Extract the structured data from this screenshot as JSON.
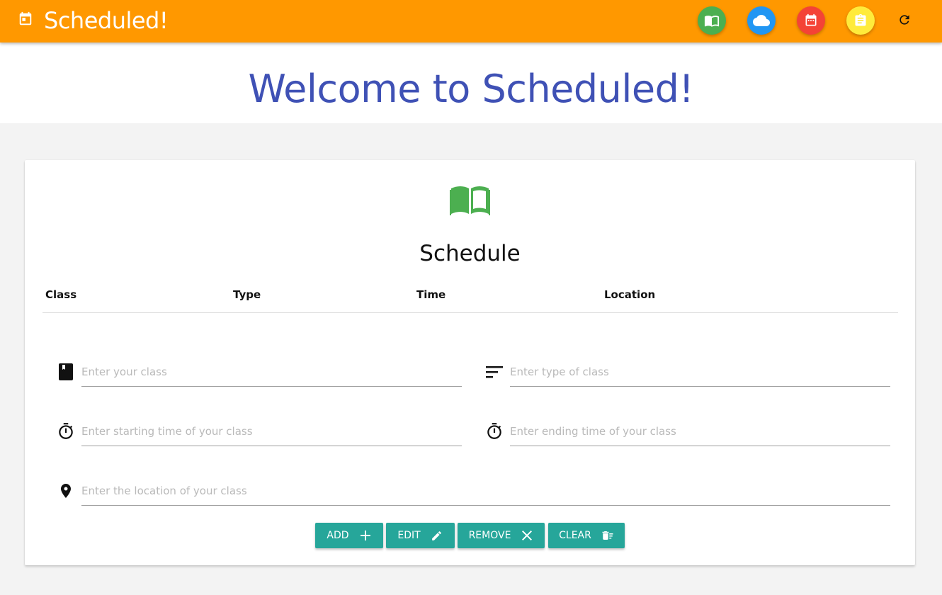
{
  "app": {
    "title": "Scheduled!"
  },
  "hero": {
    "title": "Welcome to Scheduled!"
  },
  "nav": {
    "buttons": [
      {
        "name": "schedule",
        "icon": "book-icon",
        "color": "#4caf50"
      },
      {
        "name": "weather",
        "icon": "cloud-icon",
        "color": "#2196f3"
      },
      {
        "name": "calendar",
        "icon": "calendar-icon",
        "color": "#f44336"
      },
      {
        "name": "notes",
        "icon": "clipboard-icon",
        "color": "#ffeb3b"
      }
    ],
    "refresh_icon": "refresh-icon"
  },
  "card": {
    "icon": "open-book-icon",
    "title": "Schedule",
    "columns": [
      "Class",
      "Type",
      "Time",
      "Location"
    ]
  },
  "form": {
    "class_placeholder": "Enter your class",
    "type_placeholder": "Enter type of class",
    "start_placeholder": "Enter starting time of your class",
    "end_placeholder": "Enter ending time of your class",
    "location_placeholder": "Enter the location of your class"
  },
  "buttons": {
    "add": "ADD",
    "edit": "EDIT",
    "remove": "REMOVE",
    "clear": "CLEAR"
  },
  "colors": {
    "navbar": "#ff9800",
    "hero_text": "#3f51b5",
    "accent_button": "#26a69a",
    "book_green": "#4caf50"
  }
}
